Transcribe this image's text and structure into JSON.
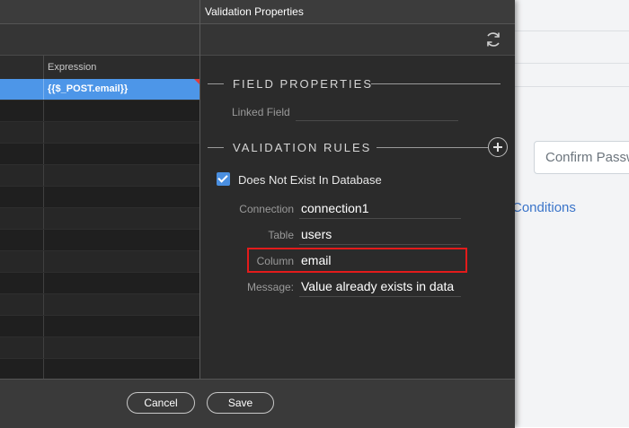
{
  "dialog": {
    "title": "Validation Properties",
    "grid": {
      "column_header": "Expression",
      "selected_value": "{{$_POST.email}}"
    },
    "field_properties": {
      "heading": "FIELD PROPERTIES",
      "linked_field_label": "Linked Field",
      "linked_field_value": ""
    },
    "validation_rules": {
      "heading": "VALIDATION RULES",
      "rule_label": "Does Not Exist In Database",
      "rule_checked": true,
      "fields": [
        {
          "label": "Connection",
          "value": "connection1"
        },
        {
          "label": "Table",
          "value": "users"
        },
        {
          "label": "Column",
          "value": "email"
        },
        {
          "label": "Message:",
          "value": "Value already exists in data"
        }
      ]
    },
    "footer": {
      "cancel_label": "Cancel",
      "save_label": "Save"
    }
  },
  "background_page": {
    "input_placeholder": "Confirm Passw",
    "link_text": "Conditions"
  },
  "colors": {
    "selection": "#4d96e8",
    "highlight_box": "#e31b1b",
    "checkbox": "#4a8fe0",
    "link": "#3a74c9"
  },
  "icons": {
    "refresh": "refresh-icon",
    "add": "plus-circle-icon",
    "check": "check-icon"
  }
}
